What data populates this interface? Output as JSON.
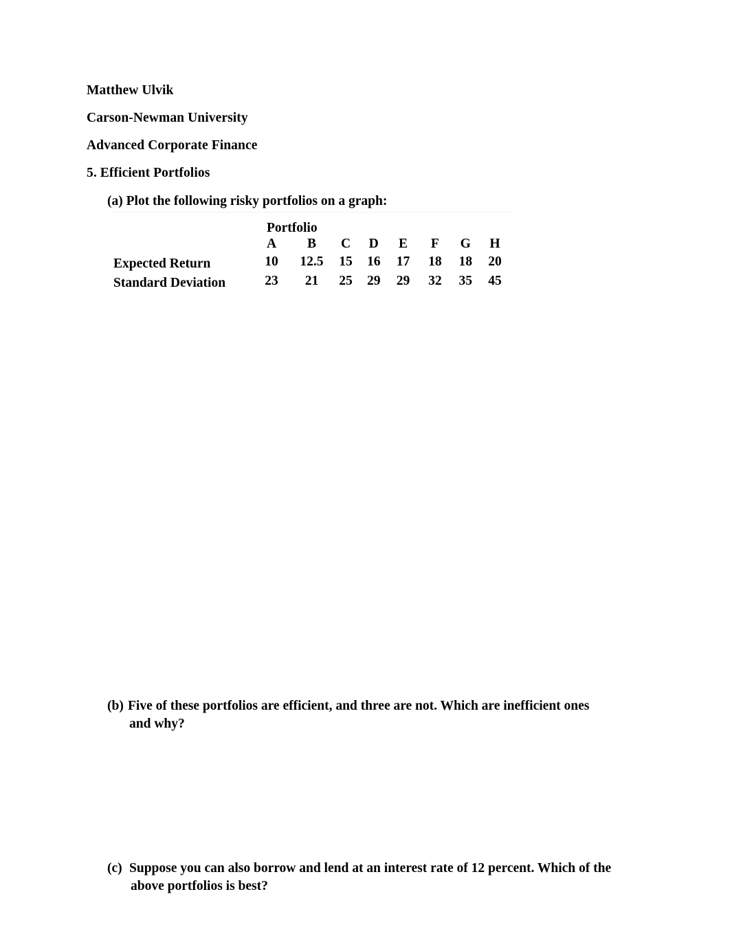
{
  "document": {
    "header_lines": [
      {
        "id": "author",
        "text": "Matthew Ulvik"
      },
      {
        "id": "school",
        "text": "Carson-Newman University"
      },
      {
        "id": "course",
        "text": "Advanced Corporate Finance"
      },
      {
        "id": "question",
        "text": "5. Efficient Portfolios"
      }
    ],
    "item_a": {
      "marker": "(a)",
      "text": "Plot the following risky portfolios on a graph:",
      "full": "(a) Plot the following risky portfolios on a graph:"
    },
    "item_b": {
      "marker": "(b)",
      "line1": "Five of these portfolios are efficient, and three are not. Which are inefficient ones",
      "line2": "and why?"
    },
    "item_c": {
      "marker": "(c)",
      "line1": "Suppose you can also borrow and lend at an interest rate of 12 percent. Which of the",
      "line2": "above portfolios is best?"
    }
  },
  "chart_data": {
    "type": "table",
    "title": "Portfolio",
    "spanner_label": "Portfolio",
    "categories": [
      "A",
      "B",
      "C",
      "D",
      "E",
      "F",
      "G",
      "H"
    ],
    "row_labels": [
      "Expected Return",
      "Standard Deviation"
    ],
    "series": [
      {
        "name": "Expected Return",
        "values": [
          10,
          12.5,
          15,
          16,
          17,
          18,
          18,
          20
        ],
        "display": [
          "10",
          "12.5",
          "15",
          "16",
          "17",
          "18",
          "18",
          "20"
        ]
      },
      {
        "name": "Standard Deviation",
        "values": [
          23,
          21,
          25,
          29,
          29,
          32,
          35,
          45
        ],
        "display": [
          "23",
          "21",
          "25",
          "29",
          "29",
          "32",
          "35",
          "45"
        ]
      }
    ],
    "xlabel": "Portfolio",
    "ylabel": "",
    "grid": false,
    "legend": "none",
    "border_color": "#f1f1f1"
  },
  "colors": {
    "page_background": "#ffffff",
    "text": "#000000",
    "table_rule": "#f1f1f1"
  }
}
